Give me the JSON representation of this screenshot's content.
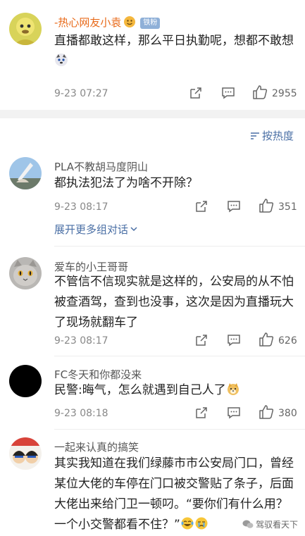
{
  "top_comment": {
    "username": "-热心网友小袁",
    "badge": "铁粉",
    "text": "直播都敢这样，那么平日执勤呢，想都不敢想",
    "date": "9-23 07:27",
    "likes": "2955"
  },
  "sort_label": "按热度",
  "comments": [
    {
      "username": "PLA不教胡马度阴山",
      "text": "都执法犯法了为啥不开除？",
      "date": "9-23 08:17",
      "likes": "351"
    },
    {
      "username": "爱车的小王哥哥",
      "text": "不管信不信现实就是这样的，公安局的从不怕被查酒驾，查到也没事，这次是因为直播玩大了现场就翻车了",
      "date": "9-23 08:17",
      "likes": "626"
    },
    {
      "username": "FC冬天和你都没来",
      "text": "民警:晦气，怎么就遇到自己人了",
      "date": "9-23 08:18",
      "likes": "380"
    },
    {
      "username": "一起来认真的搞笑",
      "text": "其实我知道在我们绿藤市市公安局门口，曾经某位大佬的车停在门口被交警贴了条子，后面大佬出来给门卫一顿叼。“要你们有什么用？一个小交警都看不住？”"
    }
  ],
  "expand_replies": "展开更多组对话",
  "watermark": "驾驭看天下",
  "colors": {
    "link": "#4a6fa5",
    "username_highlight": "#e86a1a",
    "badge": "#8fb0d8"
  }
}
